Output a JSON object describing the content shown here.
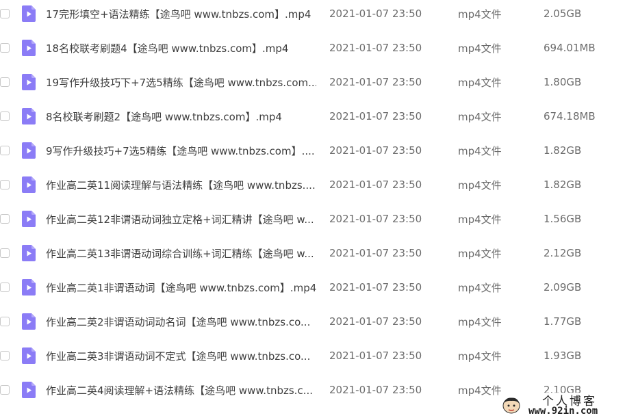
{
  "colors": {
    "file_icon": "#8b7cf6",
    "play_glyph": "#ffffff",
    "name_text": "#3d3d3d",
    "meta_text": "#6b6b6b"
  },
  "icons": {
    "row_checkbox": "checkbox-icon",
    "file": "video-file-icon"
  },
  "files": [
    {
      "name": "17完形填空+语法精练【途鸟吧 www.tnbzs.com】.mp4",
      "date": "2021-01-07 23:50",
      "type": "mp4文件",
      "size": "2.05GB"
    },
    {
      "name": "18名校联考刷题4【途鸟吧 www.tnbzs.com】.mp4",
      "date": "2021-01-07 23:50",
      "type": "mp4文件",
      "size": "694.01MB"
    },
    {
      "name": "19写作升级技巧下+7选5精练【途鸟吧 www.tnbzs.com...",
      "date": "2021-01-07 23:50",
      "type": "mp4文件",
      "size": "1.80GB"
    },
    {
      "name": "8名校联考刷题2【途鸟吧 www.tnbzs.com】.mp4",
      "date": "2021-01-07 23:50",
      "type": "mp4文件",
      "size": "674.18MB"
    },
    {
      "name": "9写作升级技巧+7选5精练【途鸟吧 www.tnbzs.com】....",
      "date": "2021-01-07 23:50",
      "type": "mp4文件",
      "size": "1.82GB"
    },
    {
      "name": "作业高二英11阅读理解与语法精练【途鸟吧 www.tnbzs....",
      "date": "2021-01-07 23:50",
      "type": "mp4文件",
      "size": "1.82GB"
    },
    {
      "name": "作业高二英12非谓语动词独立定格+词汇精讲【途鸟吧 w...",
      "date": "2021-01-07 23:50",
      "type": "mp4文件",
      "size": "1.56GB"
    },
    {
      "name": "作业高二英13非谓语动词综合训练+词汇精练【途鸟吧 w...",
      "date": "2021-01-07 23:50",
      "type": "mp4文件",
      "size": "2.12GB"
    },
    {
      "name": "作业高二英1非谓语动词【途鸟吧 www.tnbzs.com】.mp4",
      "date": "2021-01-07 23:50",
      "type": "mp4文件",
      "size": "2.09GB"
    },
    {
      "name": "作业高二英2非谓语动词动名词【途鸟吧 www.tnbzs.co...",
      "date": "2021-01-07 23:50",
      "type": "mp4文件",
      "size": "1.77GB"
    },
    {
      "name": "作业高二英3非谓语动词不定式【途鸟吧 www.tnbzs.co...",
      "date": "2021-01-07 23:50",
      "type": "mp4文件",
      "size": "1.93GB"
    },
    {
      "name": "作业高二英4阅读理解+语法精练【途鸟吧 www.tnbzs.c...",
      "date": "2021-01-07 23:50",
      "type": "mp4文件",
      "size": "2.10GB"
    }
  ],
  "watermark": {
    "title": "个人博客",
    "url": "www.92in.com"
  }
}
